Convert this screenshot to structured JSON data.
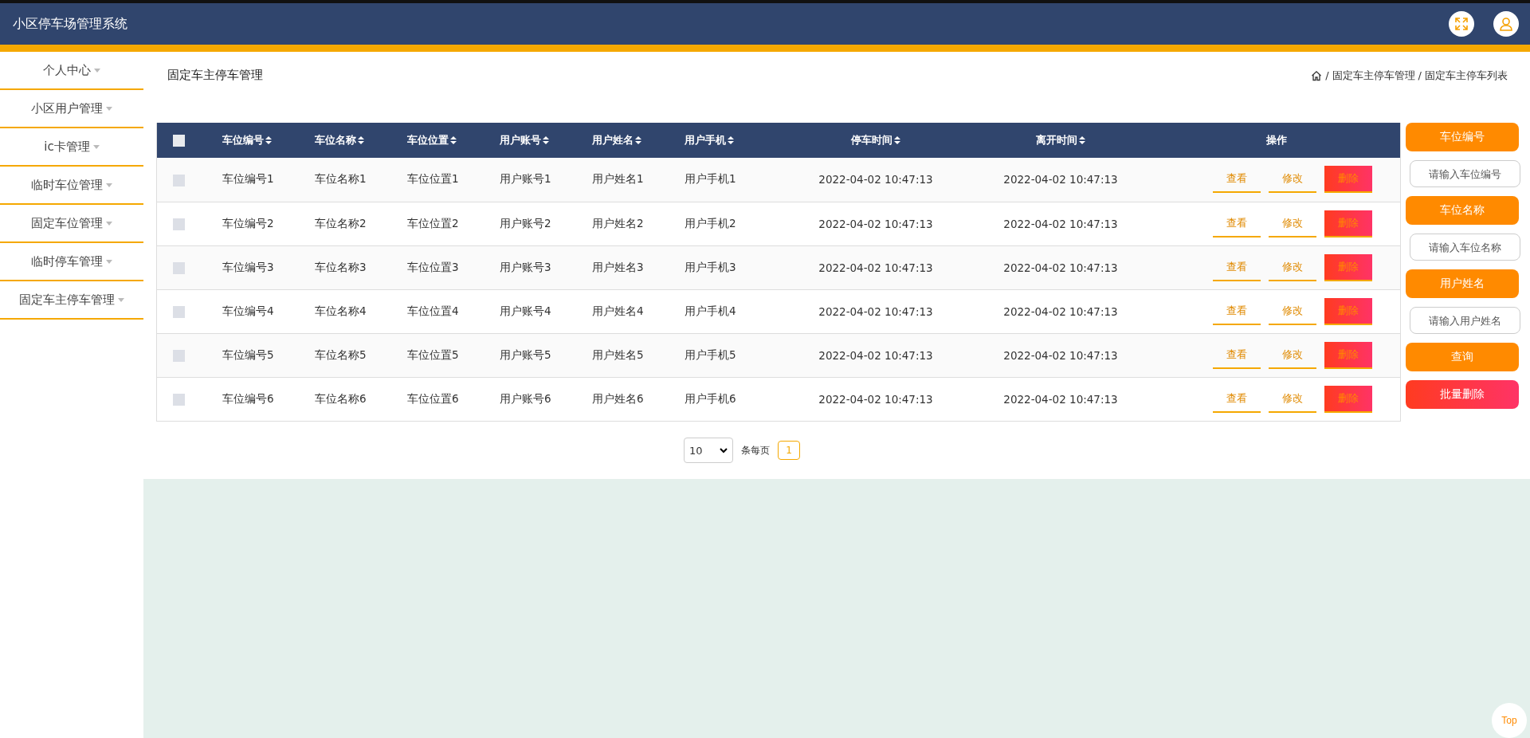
{
  "header": {
    "title": "小区停车场管理系统"
  },
  "sidebar": {
    "items": [
      {
        "label": "个人中心"
      },
      {
        "label": "小区用户管理"
      },
      {
        "label": "ic卡管理"
      },
      {
        "label": "临时车位管理"
      },
      {
        "label": "固定车位管理"
      },
      {
        "label": "临时停车管理"
      },
      {
        "label": "固定车主停车管理"
      }
    ]
  },
  "page_title": "固定车主停车管理",
  "breadcrumb": {
    "separator": "/",
    "items": [
      "固定车主停车管理",
      "固定车主停车列表"
    ]
  },
  "table": {
    "columns": [
      "车位编号",
      "车位名称",
      "车位位置",
      "用户账号",
      "用户姓名",
      "用户手机",
      "停车时间",
      "离开时间",
      "操作"
    ],
    "header_checked": false,
    "rows": [
      {
        "checked": false,
        "cells": [
          "车位编号1",
          "车位名称1",
          "车位位置1",
          "用户账号1",
          "用户姓名1",
          "用户手机1",
          "2022-04-02 10:47:13",
          "2022-04-02 10:47:13"
        ],
        "actions": [
          "查看",
          "修改",
          "删除"
        ]
      },
      {
        "checked": false,
        "cells": [
          "车位编号2",
          "车位名称2",
          "车位位置2",
          "用户账号2",
          "用户姓名2",
          "用户手机2",
          "2022-04-02 10:47:13",
          "2022-04-02 10:47:13"
        ],
        "actions": [
          "查看",
          "修改",
          "删除"
        ]
      },
      {
        "checked": false,
        "cells": [
          "车位编号3",
          "车位名称3",
          "车位位置3",
          "用户账号3",
          "用户姓名3",
          "用户手机3",
          "2022-04-02 10:47:13",
          "2022-04-02 10:47:13"
        ],
        "actions": [
          "查看",
          "修改",
          "删除"
        ]
      },
      {
        "checked": false,
        "cells": [
          "车位编号4",
          "车位名称4",
          "车位位置4",
          "用户账号4",
          "用户姓名4",
          "用户手机4",
          "2022-04-02 10:47:13",
          "2022-04-02 10:47:13"
        ],
        "actions": [
          "查看",
          "修改",
          "删除"
        ]
      },
      {
        "checked": false,
        "cells": [
          "车位编号5",
          "车位名称5",
          "车位位置5",
          "用户账号5",
          "用户姓名5",
          "用户手机5",
          "2022-04-02 10:47:13",
          "2022-04-02 10:47:13"
        ],
        "actions": [
          "查看",
          "修改",
          "删除"
        ]
      },
      {
        "checked": false,
        "cells": [
          "车位编号6",
          "车位名称6",
          "车位位置6",
          "用户账号6",
          "用户姓名6",
          "用户手机6",
          "2022-04-02 10:47:13",
          "2022-04-02 10:47:13"
        ],
        "actions": [
          "查看",
          "修改",
          "删除"
        ]
      }
    ]
  },
  "search_panel": {
    "fields": [
      {
        "label": "车位编号",
        "placeholder": "请输入车位编号"
      },
      {
        "label": "车位名称",
        "placeholder": "请输入车位名称"
      },
      {
        "label": "用户姓名",
        "placeholder": "请输入用户姓名"
      }
    ],
    "buttons": [
      {
        "kind": "search",
        "label": "查询"
      },
      {
        "kind": "danger",
        "label": "批量删除"
      }
    ]
  },
  "pagination": {
    "page_size": "10",
    "page_size_label": "条每页",
    "pages": [
      {
        "label": "1",
        "selected": true
      }
    ]
  },
  "back_to_top": "Top"
}
